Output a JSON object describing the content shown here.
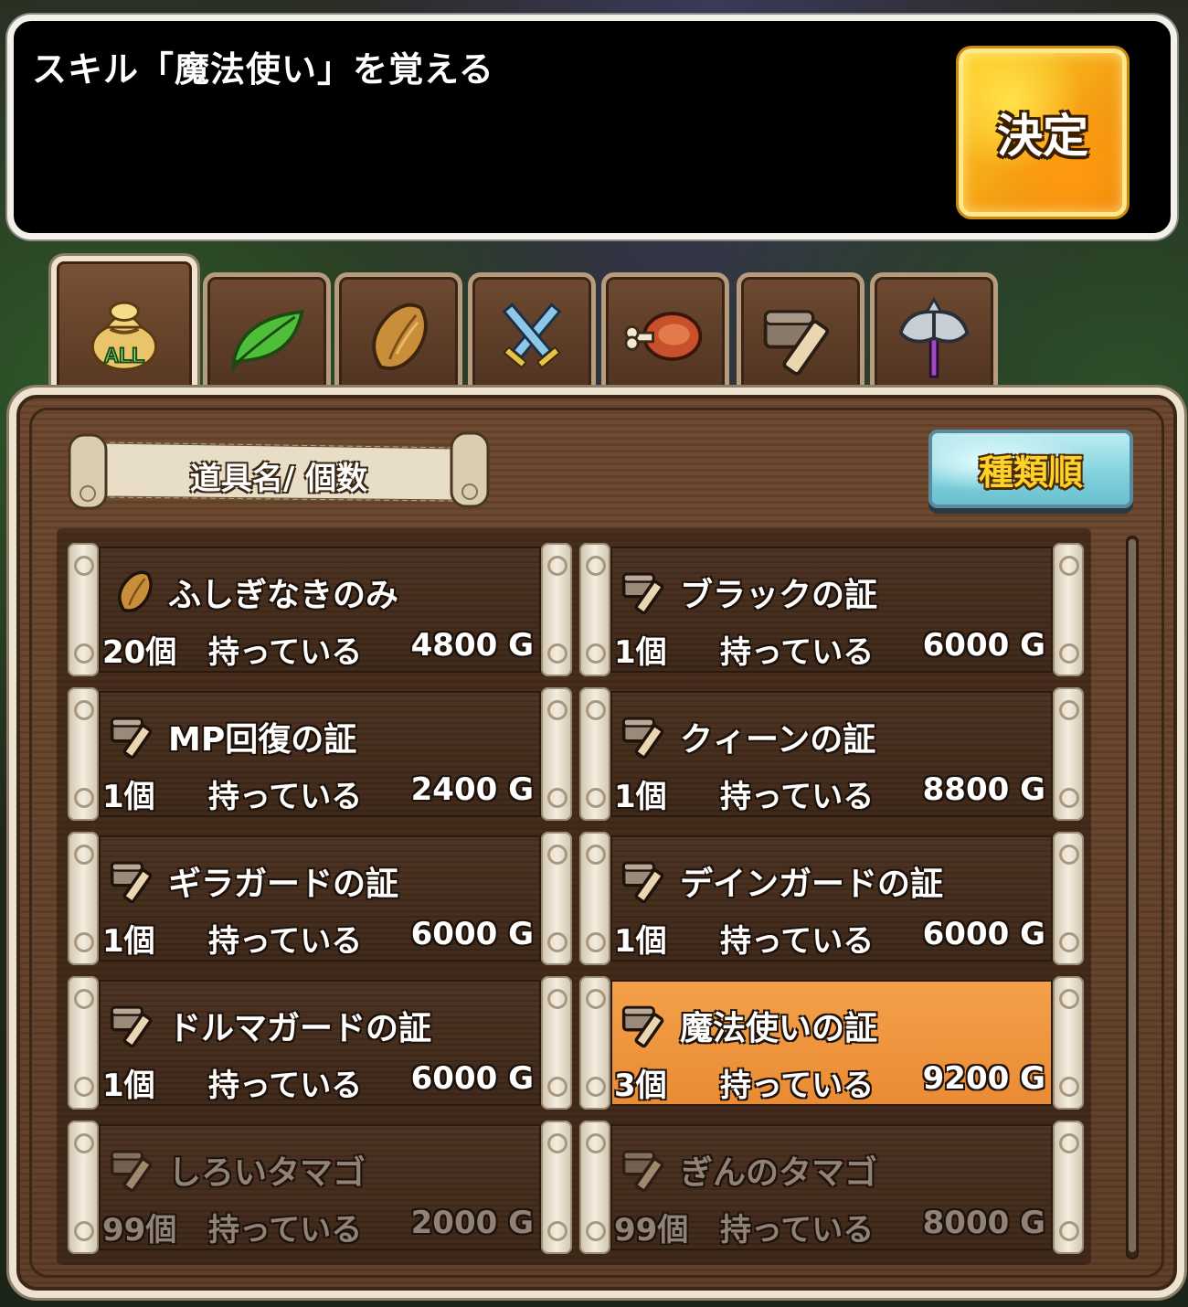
{
  "dialog": {
    "message": "スキル「魔法使い」を覚える",
    "confirm_label": "決定"
  },
  "tabs": [
    {
      "id": "all",
      "label": "ALL",
      "icon": "item-bag-icon",
      "active": true
    },
    {
      "id": "herb",
      "icon": "leaf-icon"
    },
    {
      "id": "seed",
      "icon": "seed-icon"
    },
    {
      "id": "equipment",
      "icon": "crossed-swords-icon"
    },
    {
      "id": "food",
      "icon": "meat-icon"
    },
    {
      "id": "certificate",
      "icon": "chest-scroll-icon"
    },
    {
      "id": "weapon",
      "icon": "axe-icon"
    }
  ],
  "list_header": {
    "title": "道具名/ 個数",
    "sort_label": "種類順"
  },
  "items": [
    {
      "name": "ふしぎなきのみ",
      "count": "20個",
      "status": "持っている",
      "price": "4800 G",
      "icon": "seed-icon",
      "selected": false,
      "dim": false
    },
    {
      "name": "ブラックの証",
      "count": "1個",
      "status": "持っている",
      "price": "6000 G",
      "icon": "chest-scroll-icon",
      "selected": false,
      "dim": false
    },
    {
      "name": "MP回復の証",
      "count": "1個",
      "status": "持っている",
      "price": "2400 G",
      "icon": "chest-scroll-icon",
      "selected": false,
      "dim": false
    },
    {
      "name": "クィーンの証",
      "count": "1個",
      "status": "持っている",
      "price": "8800 G",
      "icon": "chest-scroll-icon",
      "selected": false,
      "dim": false
    },
    {
      "name": "ギラガードの証",
      "count": "1個",
      "status": "持っている",
      "price": "6000 G",
      "icon": "chest-scroll-icon",
      "selected": false,
      "dim": false
    },
    {
      "name": "デインガードの証",
      "count": "1個",
      "status": "持っている",
      "price": "6000 G",
      "icon": "chest-scroll-icon",
      "selected": false,
      "dim": false
    },
    {
      "name": "ドルマガードの証",
      "count": "1個",
      "status": "持っている",
      "price": "6000 G",
      "icon": "chest-scroll-icon",
      "selected": false,
      "dim": false
    },
    {
      "name": "魔法使いの証",
      "count": "3個",
      "status": "持っている",
      "price": "9200 G",
      "icon": "chest-scroll-icon",
      "selected": true,
      "dim": false
    },
    {
      "name": "しろいタマゴ",
      "count": "99個",
      "status": "持っている",
      "price": "2000 G",
      "icon": "chest-scroll-icon",
      "selected": false,
      "dim": true
    },
    {
      "name": "ぎんのタマゴ",
      "count": "99個",
      "status": "持っている",
      "price": "8000 G",
      "icon": "chest-scroll-icon",
      "selected": false,
      "dim": true
    }
  ],
  "colors": {
    "selected_row": "#e98b34",
    "confirm_button": "#f5a014",
    "sort_button": "#7ed0dc"
  }
}
